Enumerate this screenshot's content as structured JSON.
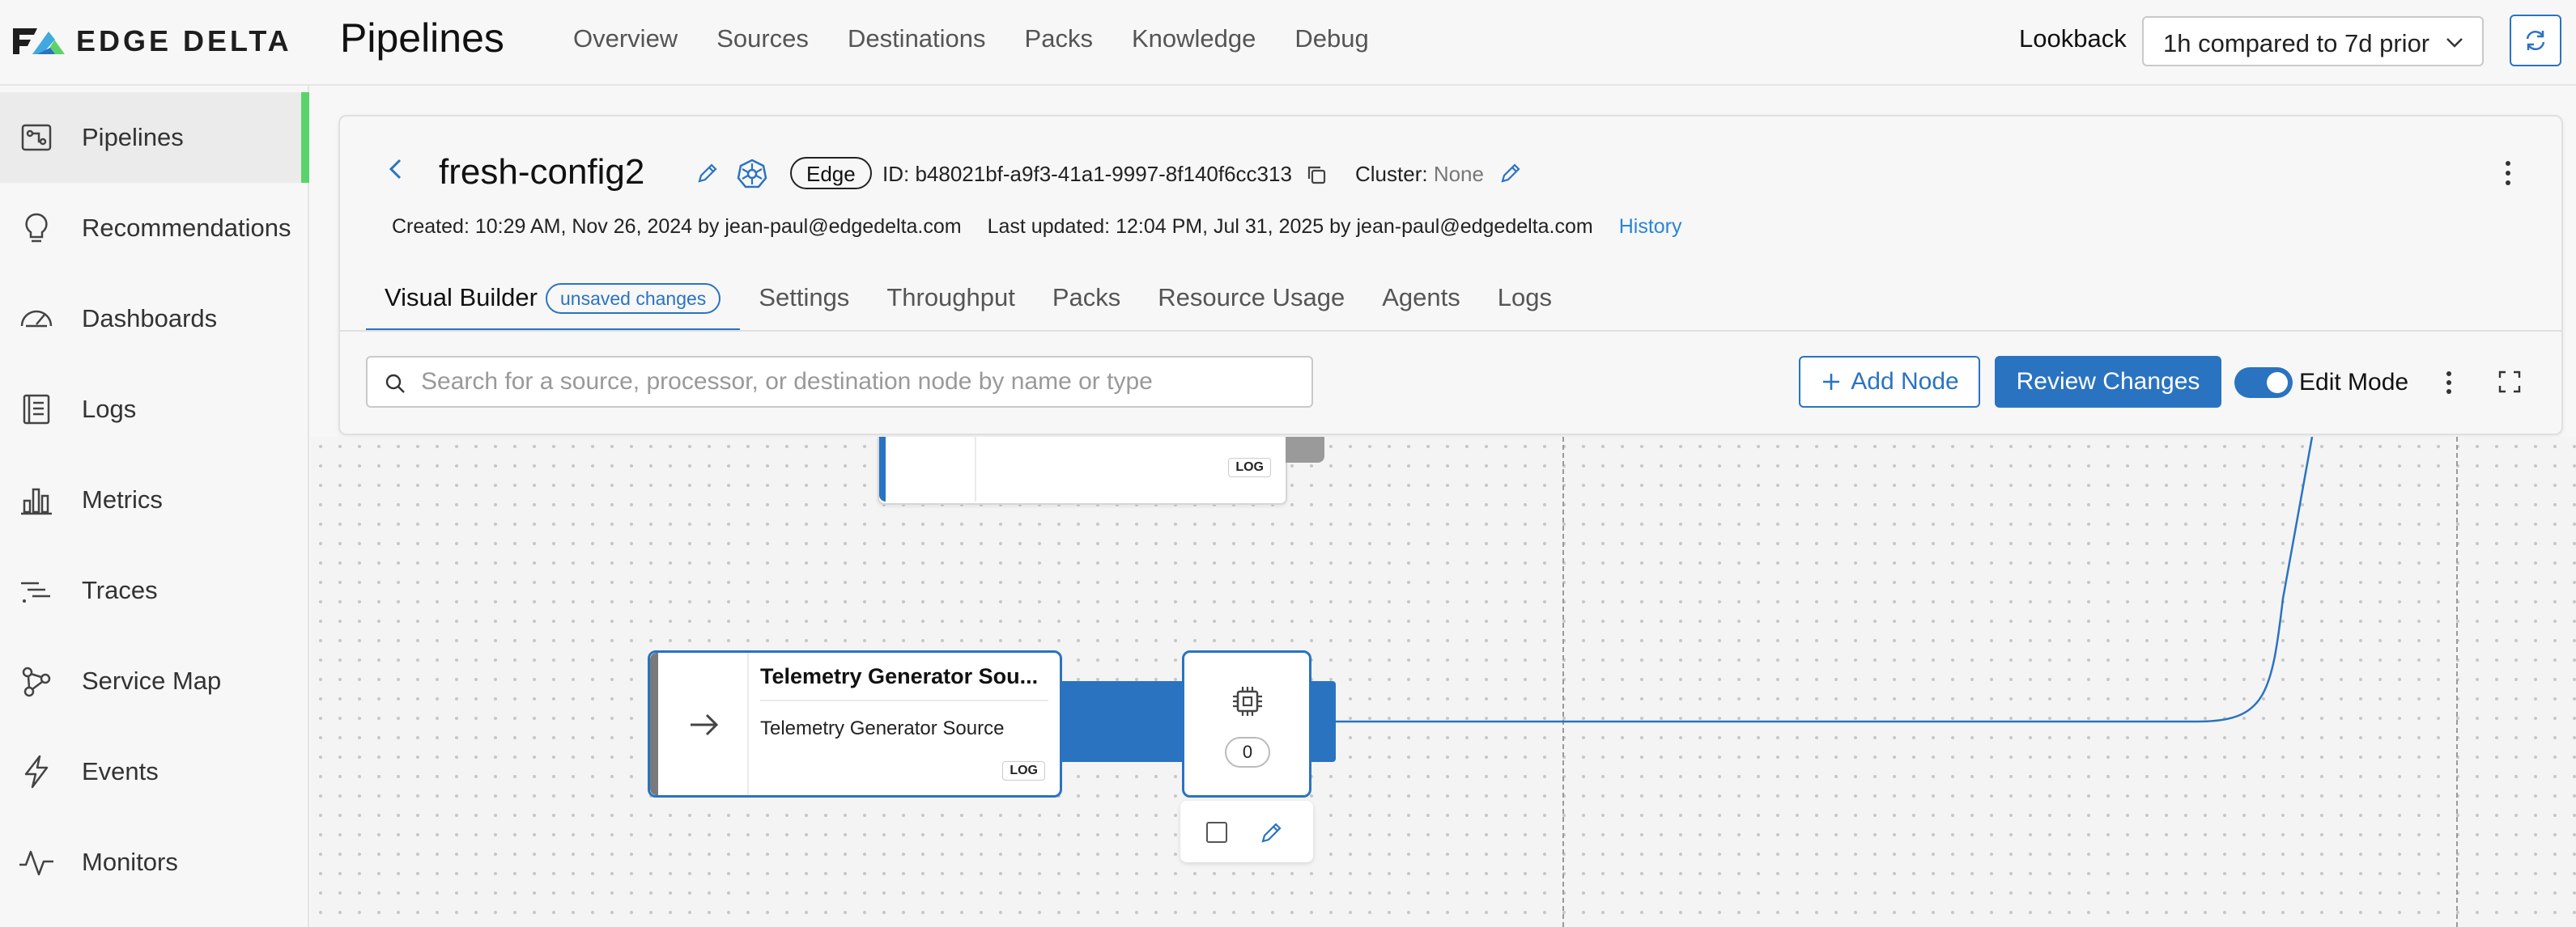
{
  "brand": {
    "name": "EDGE DELTA",
    "colors": {
      "accent": "#2a73c1",
      "active": "#5ad36b"
    }
  },
  "header": {
    "title": "Pipelines",
    "nav": [
      "Overview",
      "Sources",
      "Destinations",
      "Packs",
      "Knowledge",
      "Debug"
    ],
    "lookback_label": "Lookback",
    "lookback_value": "1h compared to 7d prior"
  },
  "sidebar": {
    "items": [
      {
        "label": "Pipelines",
        "icon": "pipelines-icon",
        "active": true
      },
      {
        "label": "Recommendations",
        "icon": "lightbulb-icon"
      },
      {
        "label": "Dashboards",
        "icon": "gauge-icon"
      },
      {
        "label": "Logs",
        "icon": "logs-icon"
      },
      {
        "label": "Metrics",
        "icon": "bar-chart-icon"
      },
      {
        "label": "Traces",
        "icon": "traces-icon"
      },
      {
        "label": "Service Map",
        "icon": "service-map-icon"
      },
      {
        "label": "Events",
        "icon": "lightning-icon"
      },
      {
        "label": "Monitors",
        "icon": "pulse-icon"
      }
    ]
  },
  "pipeline": {
    "name": "fresh-config2",
    "type_badge": "Edge",
    "id_text": "ID: b48021bf-a9f3-41a1-9997-8f140f6cc313",
    "cluster_label": "Cluster:",
    "cluster_value": "None",
    "created": "Created: 10:29 AM, Nov 26, 2024 by jean-paul@edgedelta.com",
    "updated": "Last updated: 12:04 PM, Jul 31, 2025 by jean-paul@edgedelta.com",
    "history": "History"
  },
  "tabs": {
    "items": [
      "Visual Builder",
      "Settings",
      "Throughput",
      "Packs",
      "Resource Usage",
      "Agents",
      "Logs"
    ],
    "active_badge": "unsaved changes"
  },
  "toolbar": {
    "search_placeholder": "Search for a source, processor, or destination node by name or type",
    "add_node": "Add Node",
    "review_changes": "Review Changes",
    "edit_mode": "Edit Mode"
  },
  "canvas": {
    "top_node_badge": "LOG",
    "source_node": {
      "title": "Telemetry Generator Sou...",
      "subtitle": "Telemetry Generator Source",
      "badge": "LOG"
    },
    "processor_node": {
      "count": "0"
    }
  }
}
